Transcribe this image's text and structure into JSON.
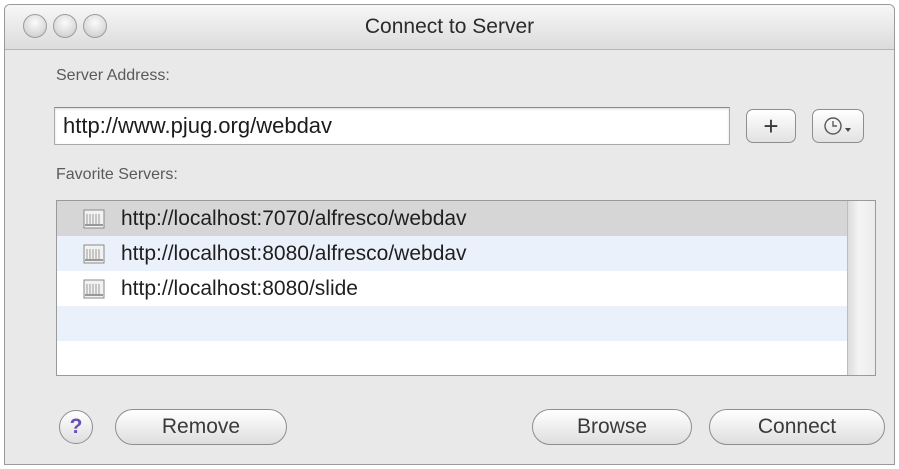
{
  "window": {
    "title": "Connect to Server"
  },
  "address": {
    "label": "Server Address:",
    "value": "http://www.pjug.org/webdav",
    "add_label": "+",
    "recent_icon": "clock-icon"
  },
  "favorites": {
    "label": "Favorite Servers:",
    "items": [
      {
        "url": "http://localhost:7070/alfresco/webdav",
        "icon": "server-icon",
        "selected": true
      },
      {
        "url": "http://localhost:8080/alfresco/webdav",
        "icon": "server-icon",
        "selected": false
      },
      {
        "url": "http://localhost:8080/slide",
        "icon": "server-icon",
        "selected": false
      }
    ]
  },
  "footer": {
    "help_label": "?",
    "remove_label": "Remove",
    "browse_label": "Browse",
    "connect_label": "Connect"
  },
  "colors": {
    "selected_row": "#d6d6d6",
    "alternate_row": "#ebf1fb",
    "help_glyph": "#6a4fb4"
  }
}
